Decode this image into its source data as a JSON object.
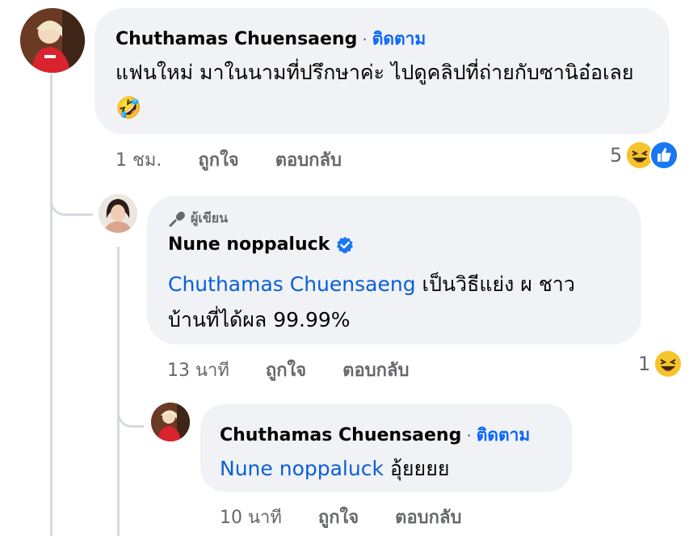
{
  "comments": [
    {
      "author": "Chuthamas Chuensaeng",
      "separator": "·",
      "follow_label": "ติดตาม",
      "text": "แฟนใหม่ มาในนามที่ปรึกษาค่ะ ไปดูคลิปที่ถ่ายกับซานิอ๋อเลย",
      "emoji": "🤣",
      "time": "1 ชม.",
      "like_label": "ถูกใจ",
      "reply_label": "ตอบกลับ",
      "reaction_count": "5",
      "reactions": [
        "laugh-emoji",
        "like-icon"
      ]
    },
    {
      "badge_label": "ผู้เขียน",
      "author": "Nune noppaluck",
      "verified": true,
      "mention": "Chuthamas Chuensaeng",
      "text_line1": " เป็นวิธีแย่ง ผ ชาว",
      "text_line2": "บ้านที่ได้ผล 99.99%",
      "time": "13 นาที",
      "like_label": "ถูกใจ",
      "reply_label": "ตอบกลับ",
      "reaction_count": "1",
      "reactions": [
        "laugh-emoji"
      ]
    },
    {
      "author": "Chuthamas Chuensaeng",
      "separator": "·",
      "follow_label": "ติดตาม",
      "mention": "Nune noppaluck",
      "text": " อุ้ยยยย",
      "time": "10 นาที",
      "like_label": "ถูกใจ",
      "reply_label": "ตอบกลับ"
    }
  ],
  "colors": {
    "bubble": "#f0f2f5",
    "link": "#0a5fd9",
    "follow": "#0866ff",
    "meta": "#65676b",
    "line": "#d6d9de"
  }
}
